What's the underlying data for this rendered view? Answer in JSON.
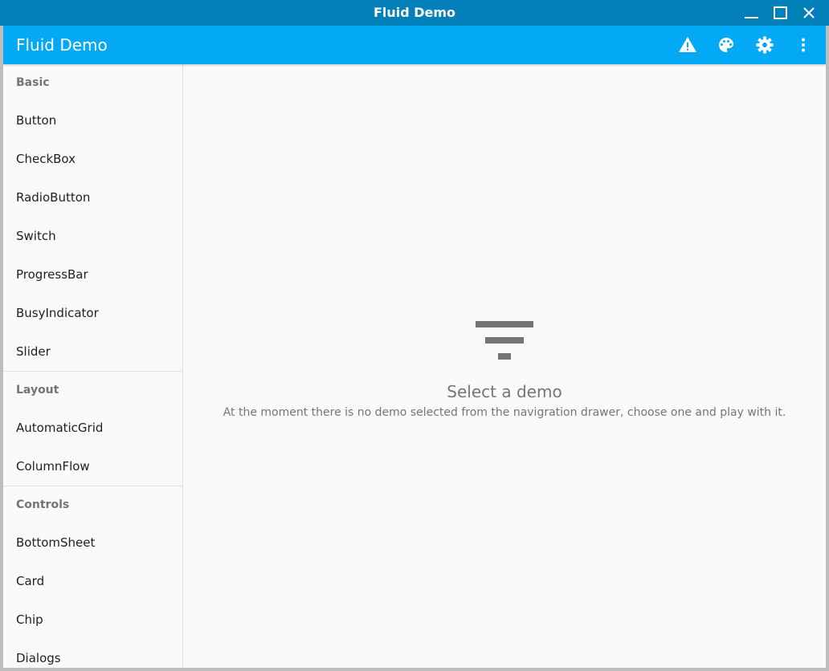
{
  "window": {
    "title": "Fluid Demo",
    "controls": [
      "minimize-icon",
      "maximize-icon",
      "close-icon"
    ]
  },
  "appbar": {
    "title": "Fluid Demo",
    "actions": [
      "warning-icon",
      "palette-icon",
      "settings-icon",
      "more-vert-icon"
    ]
  },
  "drawer": {
    "sections": [
      {
        "header": "Basic",
        "items": [
          "Button",
          "CheckBox",
          "RadioButton",
          "Switch",
          "ProgressBar",
          "BusyIndicator",
          "Slider"
        ]
      },
      {
        "header": "Layout",
        "items": [
          "AutomaticGrid",
          "ColumnFlow"
        ]
      },
      {
        "header": "Controls",
        "items": [
          "BottomSheet",
          "Card",
          "Chip",
          "Dialogs"
        ]
      }
    ]
  },
  "main": {
    "placeholder_icon": "filter-list-icon",
    "title": "Select a demo",
    "text": "At the moment there is no demo selected from the navigration drawer, choose one and play with it."
  },
  "colors": {
    "titlebar": "#0380b9",
    "appbar": "#03a9f4",
    "background": "#fafafa",
    "secondary_text": "#757575"
  }
}
